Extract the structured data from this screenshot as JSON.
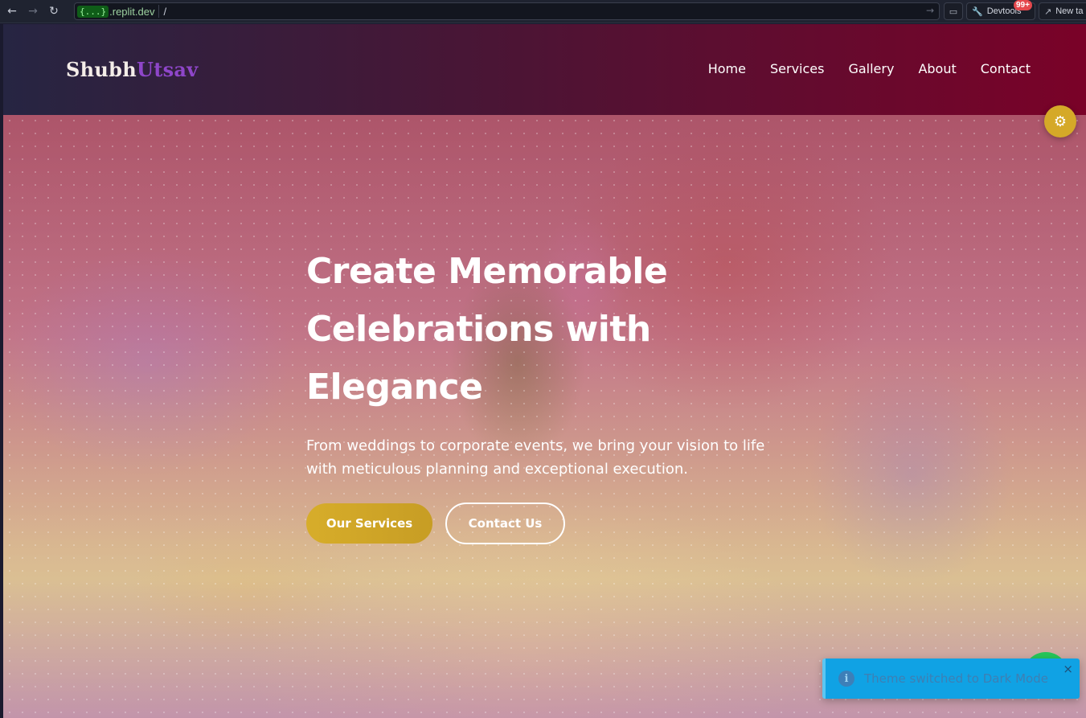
{
  "browser": {
    "back_icon": "arrow-left-icon",
    "forward_icon": "arrow-right-icon",
    "reload_icon": "reload-icon",
    "url_braces": "{...}",
    "url_host": ".replit.dev",
    "url_path": "/",
    "devtools_label": "Devtools",
    "devtools_badge": "99+",
    "newtab_label": "New ta"
  },
  "site": {
    "logo_part1": "Shubh",
    "logo_part2": "Utsav",
    "nav": [
      "Home",
      "Services",
      "Gallery",
      "About",
      "Contact"
    ]
  },
  "hero": {
    "title_line1": "Create Memorable",
    "title_line2": "Celebrations with",
    "title_line3": "Elegance",
    "subtitle": "From weddings to corporate events, we bring your vision to life with meticulous planning and exceptional execution.",
    "primary_button": "Our Services",
    "secondary_button": "Contact Us"
  },
  "toast": {
    "message": "Theme switched to Dark Mode",
    "close": "×"
  },
  "colors": {
    "accent_gold": "#d7ad2a",
    "brand_purple": "#8e46c9",
    "header_start": "#262542",
    "header_end": "#7a0228",
    "toast_bg": "#10a2e4",
    "whatsapp_green": "#25c55a"
  }
}
